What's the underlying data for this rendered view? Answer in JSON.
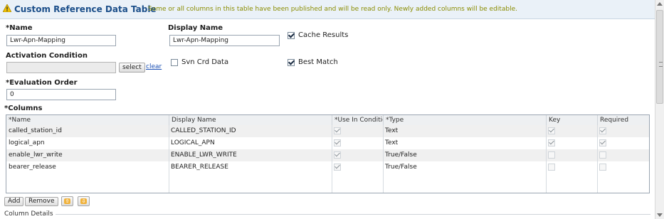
{
  "header": {
    "title": "Custom Reference Data Table",
    "message": "Some or all columns in this table have been published and will be read only.  Newly added columns will be editable."
  },
  "form": {
    "name_label": "*Name",
    "name_value": "Lwr-Apn-Mapping",
    "display_name_label": "Display Name",
    "display_name_value": "Lwr-Apn-Mapping",
    "cache_results_label": "Cache Results",
    "cache_results_checked": true,
    "activation_label": "Activation Condition",
    "activation_value": "",
    "select_label": "select",
    "clear_label": "clear",
    "svn_label": "Svn Crd Data",
    "svn_checked": false,
    "best_match_label": "Best Match",
    "best_match_checked": true,
    "eval_label": "*Evaluation Order",
    "eval_value": "0",
    "columns_label": "*Columns"
  },
  "table": {
    "headers": [
      "*Name",
      "Display Name",
      "*Use In Conditio",
      "*Type",
      "Key",
      "Required"
    ],
    "rows": [
      {
        "name": "called_station_id",
        "display": "CALLED_STATION_ID",
        "use": true,
        "type": "Text",
        "key": true,
        "required": true
      },
      {
        "name": "logical_apn",
        "display": "LOGICAL_APN",
        "use": true,
        "type": "Text",
        "key": true,
        "required": true
      },
      {
        "name": "enable_lwr_write",
        "display": "ENABLE_LWR_WRITE",
        "use": true,
        "type": "True/False",
        "key": false,
        "required": false
      },
      {
        "name": "bearer_release",
        "display": "BEARER_RELEASE",
        "use": true,
        "type": "True/False",
        "key": false,
        "required": false
      }
    ]
  },
  "buttons": {
    "add": "Add",
    "remove": "Remove",
    "move_up": "⇧",
    "move_down": "⇩"
  },
  "details": {
    "label": "Column Details"
  },
  "icons": {
    "warning": "warning-icon",
    "up": "arrow-up-icon",
    "down": "arrow-down-icon"
  }
}
